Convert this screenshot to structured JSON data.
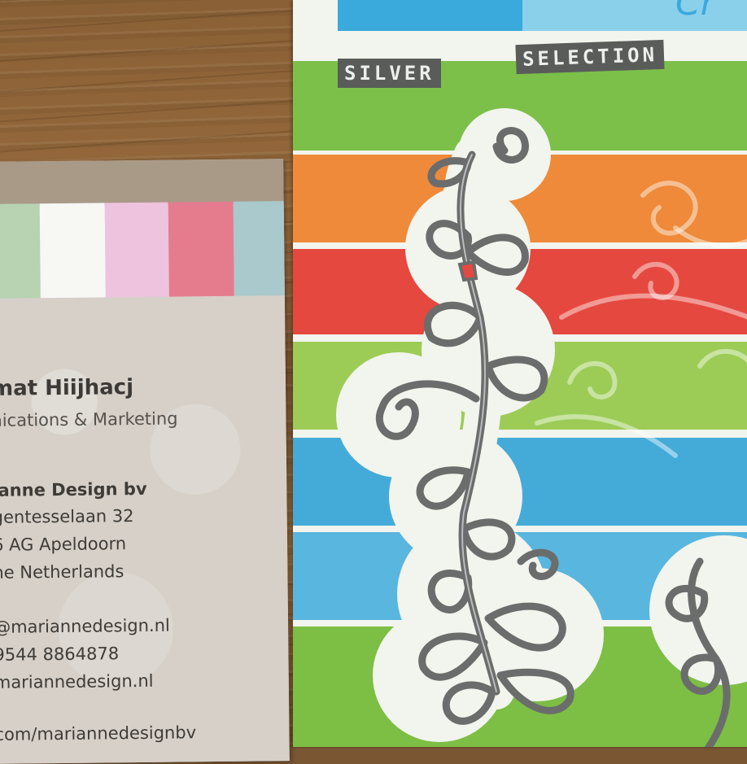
{
  "business_card": {
    "name": "mat Hiijhacj",
    "role": "nications & Marketing",
    "company": "ianne Design bv",
    "address_line1": "gentesselaan 32",
    "address_line2": "6 AG Apeldoorn",
    "address_line3": "he Netherlands",
    "email": "@mariannedesign.nl",
    "phone": "9544 8864878",
    "website": "mariannedesign.nl",
    "social": "com/mariannedesignbv",
    "flag_colors": [
      "#b7d3b2",
      "#f7f7f4",
      "#eec3de",
      "#e57c8e",
      "#a9c9cc"
    ]
  },
  "package": {
    "label_left": "SILVER",
    "label_right": "SELECTION",
    "top_logo_fragment": "Cr",
    "stripe_colors": [
      "#3aa9dc",
      "#7cc04a",
      "#ee8a39",
      "#e5483f",
      "#9ccc56",
      "#44abd9",
      "#58b6df",
      "#7dbe44"
    ],
    "die_color": "#6b6d6c"
  }
}
